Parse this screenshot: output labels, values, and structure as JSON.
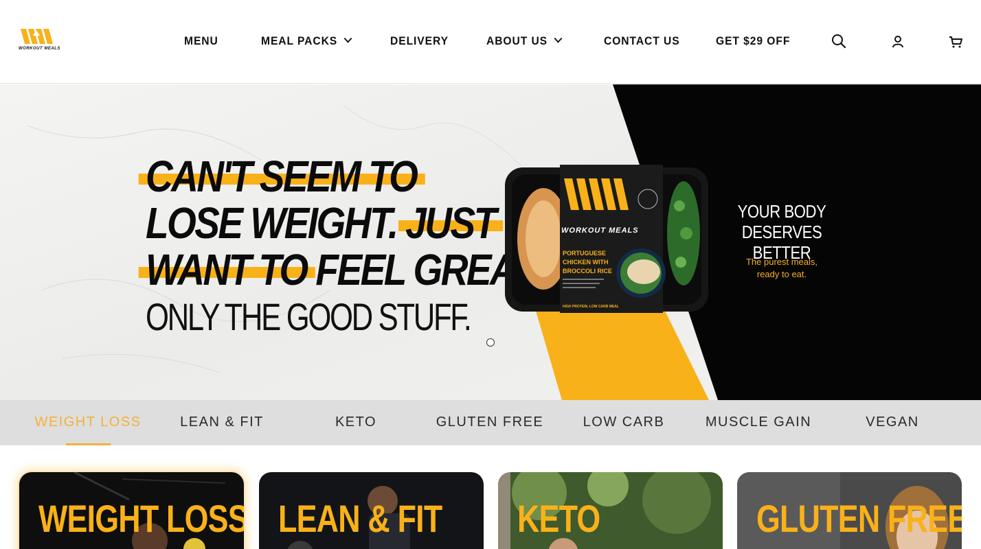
{
  "brand": {
    "name": "WORKOUT MEALS",
    "accent": "#f9b11a"
  },
  "nav": {
    "items": [
      {
        "label": "MENU",
        "dropdown": false
      },
      {
        "label": "MEAL PACKS",
        "dropdown": true
      },
      {
        "label": "DELIVERY",
        "dropdown": false
      },
      {
        "label": "ABOUT US",
        "dropdown": true
      },
      {
        "label": "CONTACT US",
        "dropdown": false
      },
      {
        "label": "GET $29 OFF",
        "dropdown": false
      }
    ],
    "icons": [
      "search-icon",
      "account-icon",
      "cart-icon"
    ]
  },
  "hero": {
    "line1": "CAN'T SEEM TO",
    "line2a": "LOSE WEIGHT.",
    "line2b": "JUST",
    "line3a": "WANT TO",
    "line3b": "FEEL GREAT.",
    "subline": "ONLY THE GOOD STUFF.",
    "product": {
      "brand": "WORKOUT MEALS",
      "name_line1": "PORTUGUESE",
      "name_line2": "CHICKEN WITH",
      "name_line3": "BROCCOLI RICE",
      "badge": "HIGH PROTEIN, LOW CARB MEAL"
    },
    "tagline_line1": "YOUR BODY",
    "tagline_line2": "DESERVES BETTER",
    "tagline_sub1": "The purest meals,",
    "tagline_sub2": "ready to eat.",
    "slide_count": 1,
    "active_slide": 1
  },
  "categories": {
    "active": "WEIGHT LOSS",
    "tabs": [
      "WEIGHT LOSS",
      "LEAN & FIT",
      "KETO",
      "GLUTEN FREE",
      "LOW CARB",
      "MUSCLE GAIN",
      "VEGAN"
    ]
  },
  "cards": [
    {
      "title": "WEIGHT LOSS"
    },
    {
      "title": "LEAN & FIT"
    },
    {
      "title": "KETO"
    },
    {
      "title": "GLUTEN FREE"
    }
  ]
}
